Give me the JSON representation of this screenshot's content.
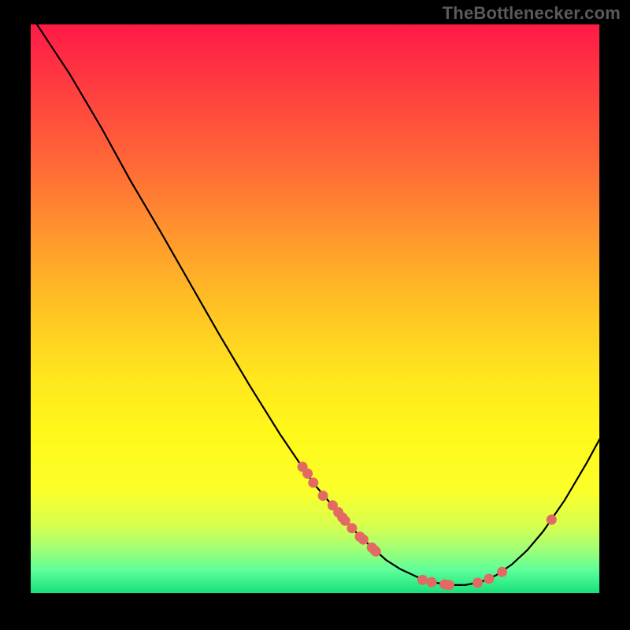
{
  "attribution": "TheBottlenecker.com",
  "colors": {
    "dot": "#e36a62",
    "line": "#000000"
  },
  "chart_data": {
    "type": "line",
    "title": "",
    "xlabel": "",
    "ylabel": "",
    "xlim": [
      0,
      100
    ],
    "ylim": [
      0,
      100
    ],
    "curve": [
      {
        "x": 0.5,
        "y": 100.9
      },
      {
        "x": 6.9,
        "y": 91.2
      },
      {
        "x": 12.5,
        "y": 81.7
      },
      {
        "x": 17.5,
        "y": 72.6
      },
      {
        "x": 22.8,
        "y": 63.6
      },
      {
        "x": 28.0,
        "y": 54.5
      },
      {
        "x": 33.2,
        "y": 45.4
      },
      {
        "x": 38.5,
        "y": 36.5
      },
      {
        "x": 43.8,
        "y": 28.0
      },
      {
        "x": 47.8,
        "y": 22.1
      },
      {
        "x": 49.9,
        "y": 19.1
      },
      {
        "x": 52.1,
        "y": 16.5
      },
      {
        "x": 55.1,
        "y": 13.0
      },
      {
        "x": 56.5,
        "y": 11.4
      },
      {
        "x": 58.2,
        "y": 9.7
      },
      {
        "x": 59.5,
        "y": 8.5
      },
      {
        "x": 60.6,
        "y": 7.5
      },
      {
        "x": 62.5,
        "y": 5.8
      },
      {
        "x": 65.0,
        "y": 4.2
      },
      {
        "x": 68.0,
        "y": 2.8
      },
      {
        "x": 70.8,
        "y": 1.9
      },
      {
        "x": 73.6,
        "y": 1.4
      },
      {
        "x": 76.4,
        "y": 1.4
      },
      {
        "x": 79.1,
        "y": 1.9
      },
      {
        "x": 81.8,
        "y": 3.1
      },
      {
        "x": 84.6,
        "y": 5.0
      },
      {
        "x": 87.3,
        "y": 7.5
      },
      {
        "x": 90.1,
        "y": 10.8
      },
      {
        "x": 93.9,
        "y": 16.3
      },
      {
        "x": 97.8,
        "y": 22.9
      },
      {
        "x": 100.3,
        "y": 27.5
      }
    ],
    "dots": [
      {
        "x": 47.8,
        "y": 22.2
      },
      {
        "x": 48.7,
        "y": 21.0
      },
      {
        "x": 49.7,
        "y": 19.4
      },
      {
        "x": 51.4,
        "y": 17.1
      },
      {
        "x": 53.1,
        "y": 15.4
      },
      {
        "x": 54.1,
        "y": 14.2
      },
      {
        "x": 54.8,
        "y": 13.3
      },
      {
        "x": 55.3,
        "y": 12.7
      },
      {
        "x": 56.5,
        "y": 11.4
      },
      {
        "x": 57.9,
        "y": 9.9
      },
      {
        "x": 58.5,
        "y": 9.4
      },
      {
        "x": 60.0,
        "y": 8.0
      },
      {
        "x": 60.5,
        "y": 7.5
      },
      {
        "x": 60.7,
        "y": 7.3
      },
      {
        "x": 68.9,
        "y": 2.3
      },
      {
        "x": 70.5,
        "y": 1.9
      },
      {
        "x": 72.8,
        "y": 1.5
      },
      {
        "x": 73.6,
        "y": 1.4
      },
      {
        "x": 78.6,
        "y": 1.8
      },
      {
        "x": 80.6,
        "y": 2.5
      },
      {
        "x": 82.9,
        "y": 3.7
      },
      {
        "x": 91.6,
        "y": 12.9
      }
    ],
    "legend": null
  }
}
